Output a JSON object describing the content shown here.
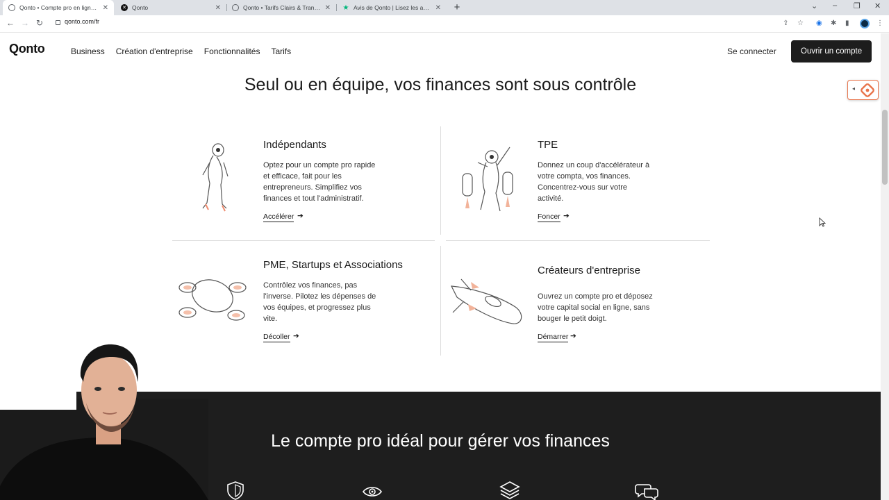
{
  "browser": {
    "tabs": [
      {
        "title": "Qonto • Compte pro en ligne po"
      },
      {
        "title": "Qonto"
      },
      {
        "title": "Qonto • Tarifs Clairs & Transpare"
      },
      {
        "title": "Avis de Qonto | Lisez les avis ma"
      }
    ],
    "new_tab": "+",
    "url": "qonto.com/fr"
  },
  "site": {
    "logo": "Qonto",
    "nav": [
      "Business",
      "Création d'entreprise",
      "Fonctionnalités",
      "Tarifs"
    ],
    "login": "Se connecter",
    "cta": "Ouvrir un compte"
  },
  "section": {
    "title": "Seul ou en équipe, vos finances sont sous contrôle",
    "cards": [
      {
        "title": "Indépendants",
        "lines": [
          "Optez pour un compte pro rapide",
          "et efficace, fait pour les",
          "entrepreneurs. Simplifiez vos",
          "finances et tout l'administratif."
        ],
        "link": "Accélérer",
        "illustration": "astronaut-icon"
      },
      {
        "title": "TPE",
        "lines": [
          "Donnez un coup d'accélérateur à",
          "votre compta, vos finances.",
          "Concentrez-vous sur votre",
          "activité."
        ],
        "link": "Foncer",
        "illustration": "jetpack-icon"
      },
      {
        "title": "PME, Startups et Associations",
        "lines": [
          "Contrôlez vos finances, pas",
          "l'inverse. Pilotez les dépenses de",
          "vos équipes, et progressez plus",
          "vite."
        ],
        "link": "Décoller",
        "illustration": "drone-icon"
      },
      {
        "title": "Créateurs d'entreprise",
        "lines": [
          "Ouvrez un compte pro et déposez",
          "votre capital social en ligne, sans",
          "bouger le petit doigt."
        ],
        "link": "Démarrer",
        "illustration": "spaceship-icon"
      }
    ]
  },
  "dark_section": {
    "title": "Le compte pro idéal pour gérer vos finances",
    "icons": [
      "shield-icon",
      "eye-icon",
      "layers-icon",
      "chat-icon"
    ]
  },
  "colors": {
    "accent": "#e8734a",
    "dark_bg": "#1e1e1e",
    "cta_bg": "#1d1d1d"
  }
}
